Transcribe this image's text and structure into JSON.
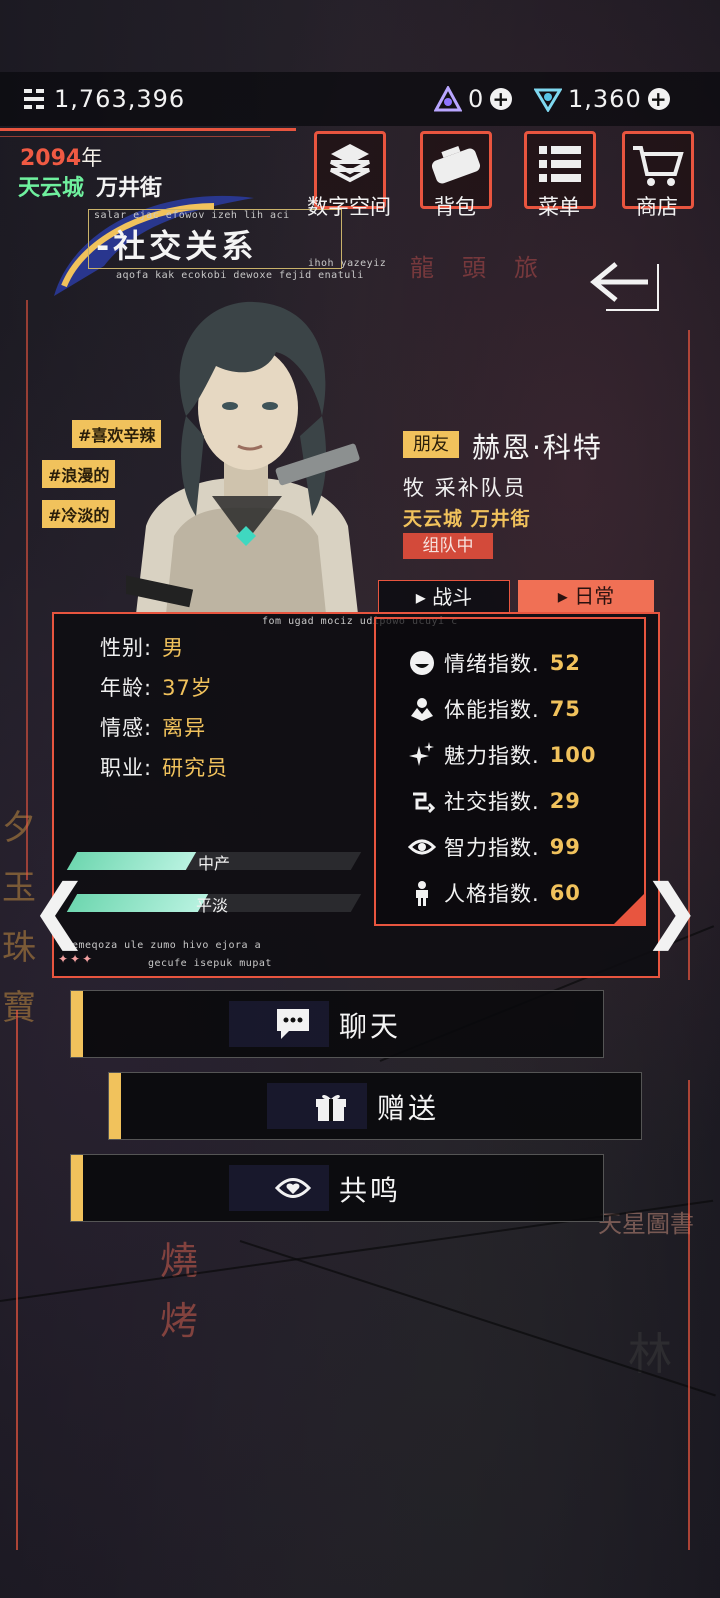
{
  "top_bar": {
    "coins": "1,763,396",
    "gems_a": "0",
    "gems_b": "1,360",
    "plus_glyph": "+"
  },
  "header": {
    "year_num": "2094",
    "year_suffix": "年",
    "city": "天云城",
    "district": "万井街",
    "title": "-社交关系",
    "deco_top": "salar ejac efowov izeh lih aci",
    "deco_bottom": "aqofa kak ecokobi dewoxe fejid enatuli",
    "deco_right": "ihoh yazeyiz"
  },
  "menu": {
    "items": [
      {
        "label": "数字空间",
        "icon": "digital-space-icon"
      },
      {
        "label": "背包",
        "icon": "backpack-icon"
      },
      {
        "label": "菜单",
        "icon": "menu-icon"
      },
      {
        "label": "商店",
        "icon": "cart-icon"
      }
    ]
  },
  "tags": [
    "#喜欢辛辣",
    "#浪漫的",
    "#冷淡的"
  ],
  "profile": {
    "relation": "朋友",
    "name": "赫恩·科特",
    "role": "牧 采补队员",
    "location": "天云城 万井街",
    "status": "组队中"
  },
  "tabs": {
    "battle": "战斗",
    "daily": "日常"
  },
  "panel": {
    "deco_top": "fom ugad mociz udipowo ucuyi c",
    "deco_bottom1": "emeqoza ule zumo hivo ejora a",
    "deco_bottom2": "gecufe isepuk mupat",
    "dots": "✦✦✦",
    "info": [
      {
        "label": "性别:",
        "value": "男"
      },
      {
        "label": "年龄:",
        "value": "37岁"
      },
      {
        "label": "情感:",
        "value": "离异"
      },
      {
        "label": "职业:",
        "value": "研究员"
      }
    ],
    "bars": [
      {
        "label": "中产",
        "fill": 0.42
      },
      {
        "label": "平淡",
        "fill": 0.46
      }
    ]
  },
  "stats": [
    {
      "label": "情绪指数.",
      "value": "52",
      "icon": "mood-icon"
    },
    {
      "label": "体能指数.",
      "value": "75",
      "icon": "stamina-icon"
    },
    {
      "label": "魅力指数.",
      "value": "100",
      "icon": "sparkle-icon"
    },
    {
      "label": "社交指数.",
      "value": "29",
      "icon": "social-icon"
    },
    {
      "label": "智力指数.",
      "value": "99",
      "icon": "eye-icon"
    },
    {
      "label": "人格指数.",
      "value": "60",
      "icon": "person-icon"
    }
  ],
  "nav": {
    "prev": "❮",
    "next": "❯"
  },
  "actions": {
    "chat": "聊天",
    "gift": "赠送",
    "resonate": "共鸣"
  },
  "bg_signs": [
    "龍",
    "頭",
    "旅",
    "燒",
    "烤",
    "天星圖書",
    "林",
    "夕",
    "玉",
    "珠",
    "寶"
  ],
  "colors": {
    "accent": "#e8553f",
    "gold": "#f1c25c",
    "green": "#6ff09e",
    "teal": "#6fd7b0"
  }
}
